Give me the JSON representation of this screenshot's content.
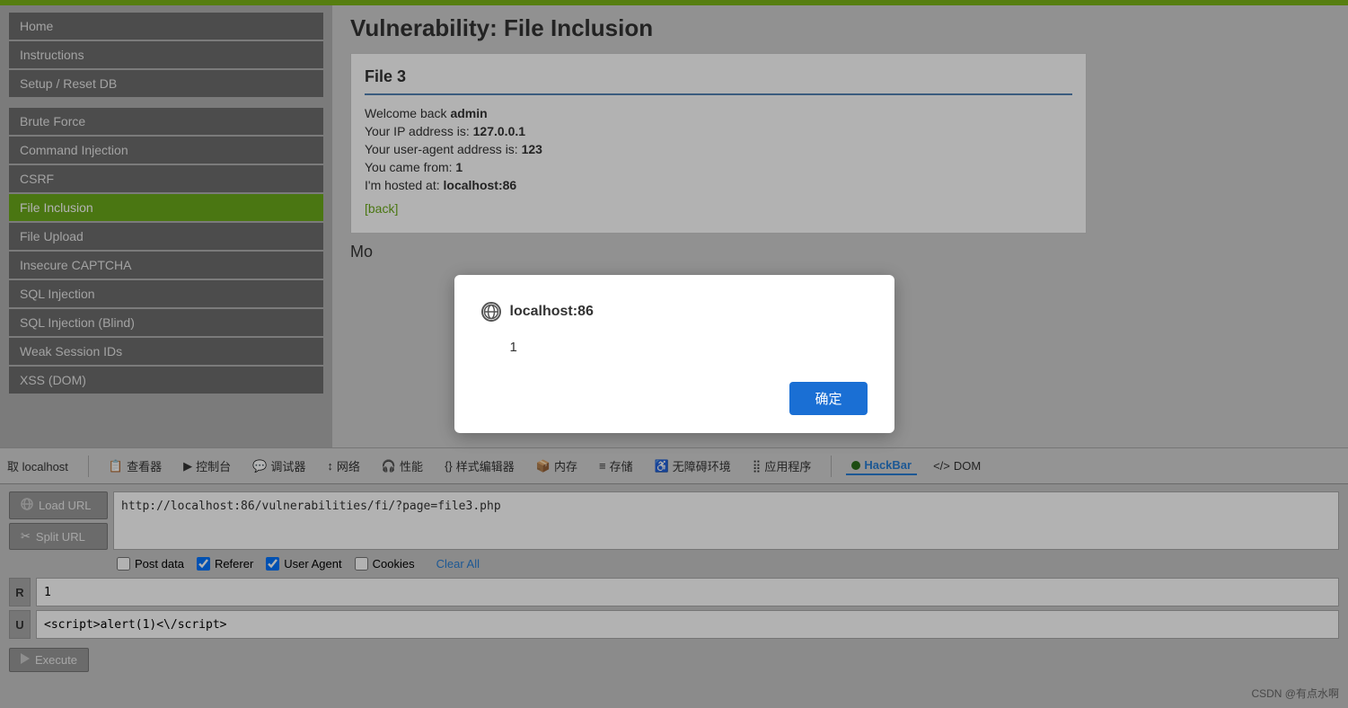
{
  "topbar": {
    "color": "#7cb518"
  },
  "sidebar": {
    "items": [
      {
        "label": "Home",
        "active": false
      },
      {
        "label": "Instructions",
        "active": false
      },
      {
        "label": "Setup / Reset DB",
        "active": false
      },
      {
        "label": "Brute Force",
        "active": false
      },
      {
        "label": "Command Injection",
        "active": false
      },
      {
        "label": "CSRF",
        "active": false
      },
      {
        "label": "File Inclusion",
        "active": true
      },
      {
        "label": "File Upload",
        "active": false
      },
      {
        "label": "Insecure CAPTCHA",
        "active": false
      },
      {
        "label": "SQL Injection",
        "active": false
      },
      {
        "label": "SQL Injection (Blind)",
        "active": false
      },
      {
        "label": "Weak Session IDs",
        "active": false
      },
      {
        "label": "XSS (DOM)",
        "active": false
      }
    ]
  },
  "page": {
    "title": "Vulnerability: File Inclusion",
    "file_box": {
      "title": "File 3",
      "line1_prefix": "Welcome back ",
      "line1_bold": "admin",
      "line2_prefix": "Your IP address is: ",
      "line2_bold": "127.0.0.1",
      "line3_prefix": "Your user-agent address is: ",
      "line3_bold": "123",
      "line4_prefix": "You came from: ",
      "line4_bold": "1",
      "line5_prefix": "I'm hosted at: ",
      "line5_bold": "localhost:86",
      "back_link": "[back]"
    },
    "more_text": "Mo"
  },
  "modal": {
    "host": "localhost:86",
    "value": "1",
    "confirm_btn": "确定"
  },
  "browser_toolbar": {
    "status": "取 localhost",
    "buttons": [
      {
        "label": "查看器",
        "icon": "👁"
      },
      {
        "label": "控制台",
        "icon": "▶"
      },
      {
        "label": "调试器",
        "icon": "💬"
      },
      {
        "label": "网络",
        "icon": "↕"
      },
      {
        "label": "性能",
        "icon": "🎧"
      },
      {
        "label": "样式编辑器",
        "icon": "{}"
      },
      {
        "label": "内存",
        "icon": "📦"
      },
      {
        "label": "存储",
        "icon": "≡"
      },
      {
        "label": "无障碍环境",
        "icon": "♿"
      },
      {
        "label": "应用程序",
        "icon": "⣿"
      },
      {
        "label": "HackBar",
        "icon": "●",
        "active": true
      },
      {
        "label": "DOM",
        "icon": "</>"
      }
    ]
  },
  "hackbar": {
    "load_url_label": "Load URL",
    "split_url_label": "Split URL",
    "execute_label": "Execute",
    "url_value": "http://localhost:86/vulnerabilities/fi/?page=file3.php",
    "url_placeholder": "",
    "options": {
      "post_data": {
        "label": "Post data",
        "checked": false
      },
      "referer": {
        "label": "Referer",
        "checked": true
      },
      "user_agent": {
        "label": "User Agent",
        "checked": true
      },
      "cookies": {
        "label": "Cookies",
        "checked": false
      },
      "clear_all": "Clear All"
    },
    "fields": [
      {
        "label": "R",
        "value": "1"
      },
      {
        "label": "U",
        "value": "<script>alert(1)<\\/script>"
      }
    ]
  },
  "watermark": "CSDN @有点水啊"
}
